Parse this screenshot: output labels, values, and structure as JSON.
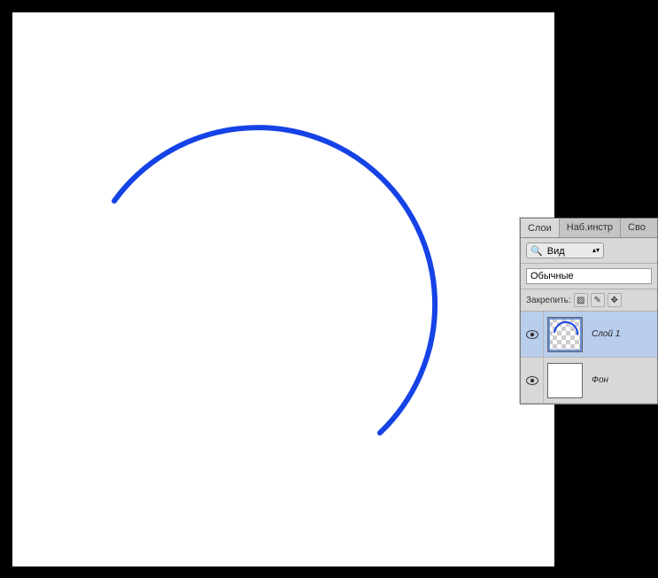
{
  "panel": {
    "tabs": {
      "layers": "Слои",
      "tools": "Наб.инстр",
      "props": "Сво"
    },
    "filter": {
      "label": "Вид"
    },
    "blend_mode": "Обычные",
    "lock": {
      "label": "Закрепить:"
    },
    "layers": [
      {
        "name": "Слой 1",
        "selected": true,
        "thumb": "checker"
      },
      {
        "name": "Фон",
        "selected": false,
        "thumb": "white"
      }
    ]
  },
  "canvas": {
    "arc_color": "#1543e6"
  }
}
